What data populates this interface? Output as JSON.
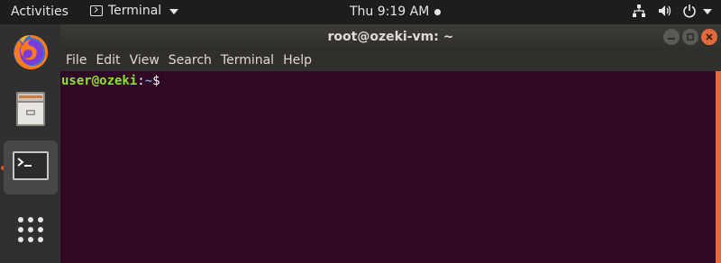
{
  "topbar": {
    "activities_label": "Activities",
    "app_menu_label": "Terminal",
    "clock_text": "Thu  9:19 AM"
  },
  "dock": {
    "items": [
      {
        "name": "Firefox",
        "icon": "firefox-icon"
      },
      {
        "name": "Files",
        "icon": "files-icon"
      },
      {
        "name": "Terminal",
        "icon": "terminal-icon",
        "active": true
      },
      {
        "name": "Show Applications",
        "icon": "app-grid-icon"
      }
    ]
  },
  "window": {
    "title": "root@ozeki-vm: ~",
    "menu": [
      "File",
      "Edit",
      "View",
      "Search",
      "Terminal",
      "Help"
    ]
  },
  "terminal": {
    "prompt_user": "user@ozeki",
    "prompt_colon": ":",
    "prompt_path": "~",
    "prompt_symbol": "$"
  },
  "colors": {
    "terminal_bg": "#300a24",
    "accent": "#e95420",
    "prompt_user": "#8ae234",
    "prompt_path": "#729fcf"
  }
}
